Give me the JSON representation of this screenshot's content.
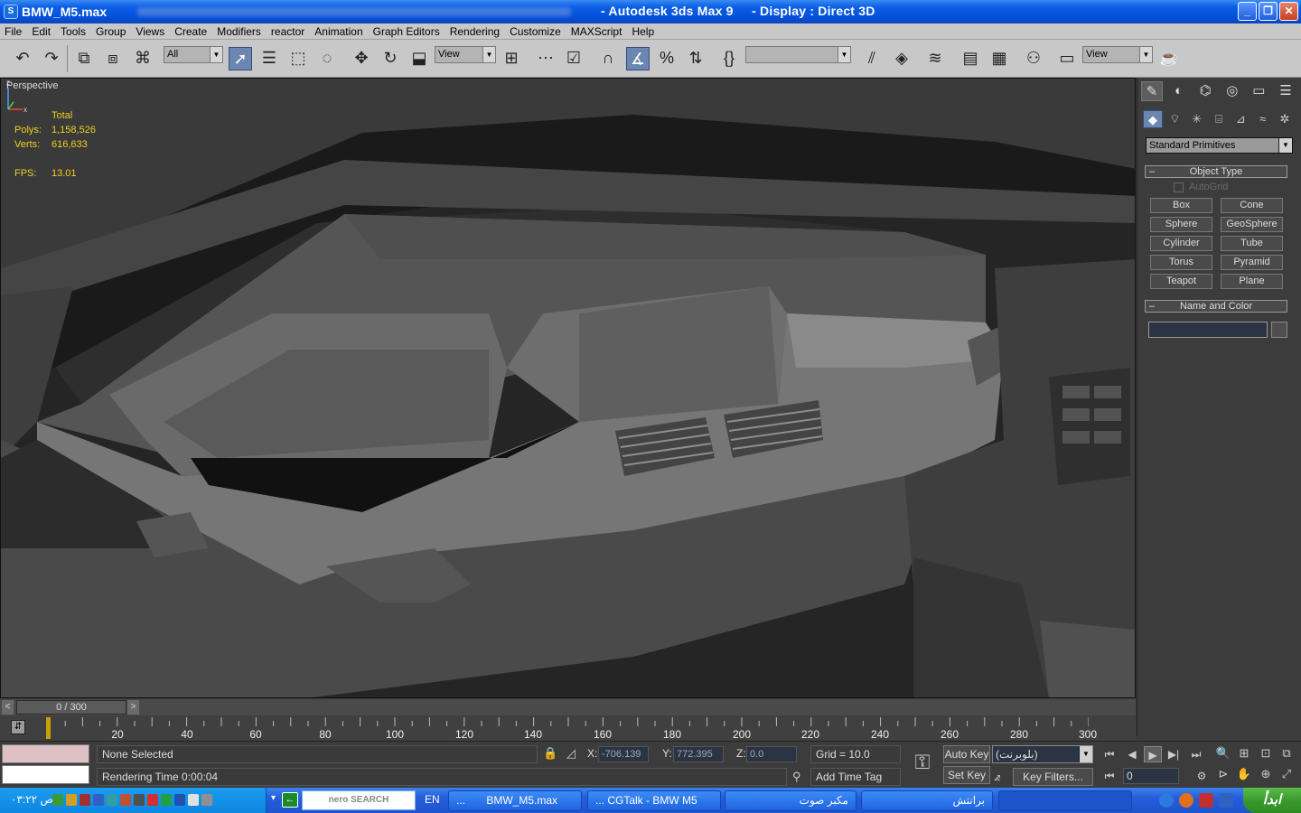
{
  "window": {
    "file_name": "BMW_M5.max",
    "app_title": "- Autodesk 3ds Max 9",
    "display_mode": "- Display : Direct 3D",
    "minimize": "_",
    "maximize": "❐",
    "close": "✕"
  },
  "menu": [
    "File",
    "Edit",
    "Tools",
    "Group",
    "Views",
    "Create",
    "Modifiers",
    "reactor",
    "Animation",
    "Graph Editors",
    "Rendering",
    "Customize",
    "MAXScript",
    "Help"
  ],
  "toolbar": {
    "selection_filter": "All",
    "ref_coord": "View",
    "named_selection": "",
    "render_view": "View"
  },
  "viewport": {
    "label": "Perspective",
    "stats": {
      "header": "Total",
      "polys_label": "Polys:",
      "polys_value": "1,158,526",
      "verts_label": "Verts:",
      "verts_value": "616,633",
      "fps_label": "FPS:",
      "fps_value": "13.01"
    },
    "axis_labels": {
      "z": "z",
      "x": "x",
      "y": "y"
    }
  },
  "timeline": {
    "slider_label": "0 / 300",
    "prev": "<",
    "next": ">",
    "ticks": [
      "20",
      "40",
      "60",
      "80",
      "100",
      "120",
      "140",
      "160",
      "180",
      "200",
      "220",
      "240",
      "260",
      "280",
      "300"
    ]
  },
  "command_panel": {
    "category_dropdown": "Standard Primitives",
    "object_type_title": "Object Type",
    "autogrid_label": "AutoGrid",
    "primitives": [
      [
        "Box",
        "Cone"
      ],
      [
        "Sphere",
        "GeoSphere"
      ],
      [
        "Cylinder",
        "Tube"
      ],
      [
        "Torus",
        "Pyramid"
      ],
      [
        "Teapot",
        "Plane"
      ]
    ],
    "name_color_title": "Name and Color",
    "rollout_minus": "–"
  },
  "status": {
    "selection": "None Selected",
    "rendering_time": "Rendering Time  0:00:04",
    "x_label": "X:",
    "x_value": "-706.139",
    "y_label": "Y:",
    "y_value": "772.395",
    "z_label": "Z:",
    "z_value": "0.0",
    "grid": "Grid = 10.0",
    "add_time_tag": "Add Time Tag",
    "auto_key": "Auto Key",
    "set_key": "Set Key",
    "key_selection": "(بلوبرنت)",
    "key_filters": "Key Filters...",
    "current_frame": "0"
  },
  "taskbar": {
    "clock": "۰۳:۲۲ ص",
    "nero_label": "nero SEARCH",
    "lang": "EN",
    "tasks": [
      "...",
      "BMW_M5.max",
      "... CGTalk - BMW M5",
      "مكبر صوت",
      "برانتش",
      ""
    ],
    "start_label": "ابدأ"
  },
  "colors": {
    "title_blue": "#0551da",
    "menu_gray": "#c8c8c8",
    "viewport_bg": "#222222",
    "stats_yellow": "#f0d020",
    "active_blue": "#6b86b0",
    "panel_gray": "#3c3c3c"
  }
}
